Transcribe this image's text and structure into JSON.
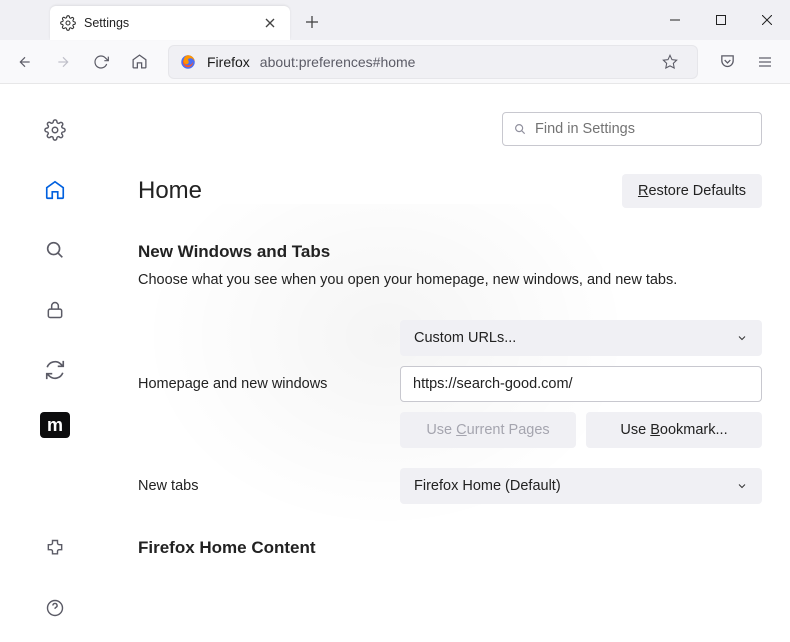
{
  "window": {
    "tab_title": "Settings",
    "new_tab_tooltip": "New Tab"
  },
  "toolbar": {
    "firefox_label": "Firefox",
    "url": "about:preferences#home"
  },
  "sidebar": {
    "branded_letter": "m"
  },
  "search": {
    "placeholder": "Find in Settings"
  },
  "page": {
    "title": "Home",
    "restore_prefix": "R",
    "restore_rest": "estore Defaults"
  },
  "section_windows_tabs": {
    "title": "New Windows and Tabs",
    "desc": "Choose what you see when you open your homepage, new windows, and new tabs."
  },
  "form": {
    "homepage_label": "Homepage and new windows",
    "homepage_select": "Custom URLs...",
    "homepage_url": "https://search-good.com/",
    "use_current_pre": "Use ",
    "use_current_u": "C",
    "use_current_post": "urrent Pages",
    "use_bookmark_pre": "Use ",
    "use_bookmark_u": "B",
    "use_bookmark_post": "ookmark...",
    "newtabs_label": "New tabs",
    "newtabs_select": "Firefox Home (Default)"
  },
  "section_content": {
    "title": "Firefox Home Content"
  }
}
